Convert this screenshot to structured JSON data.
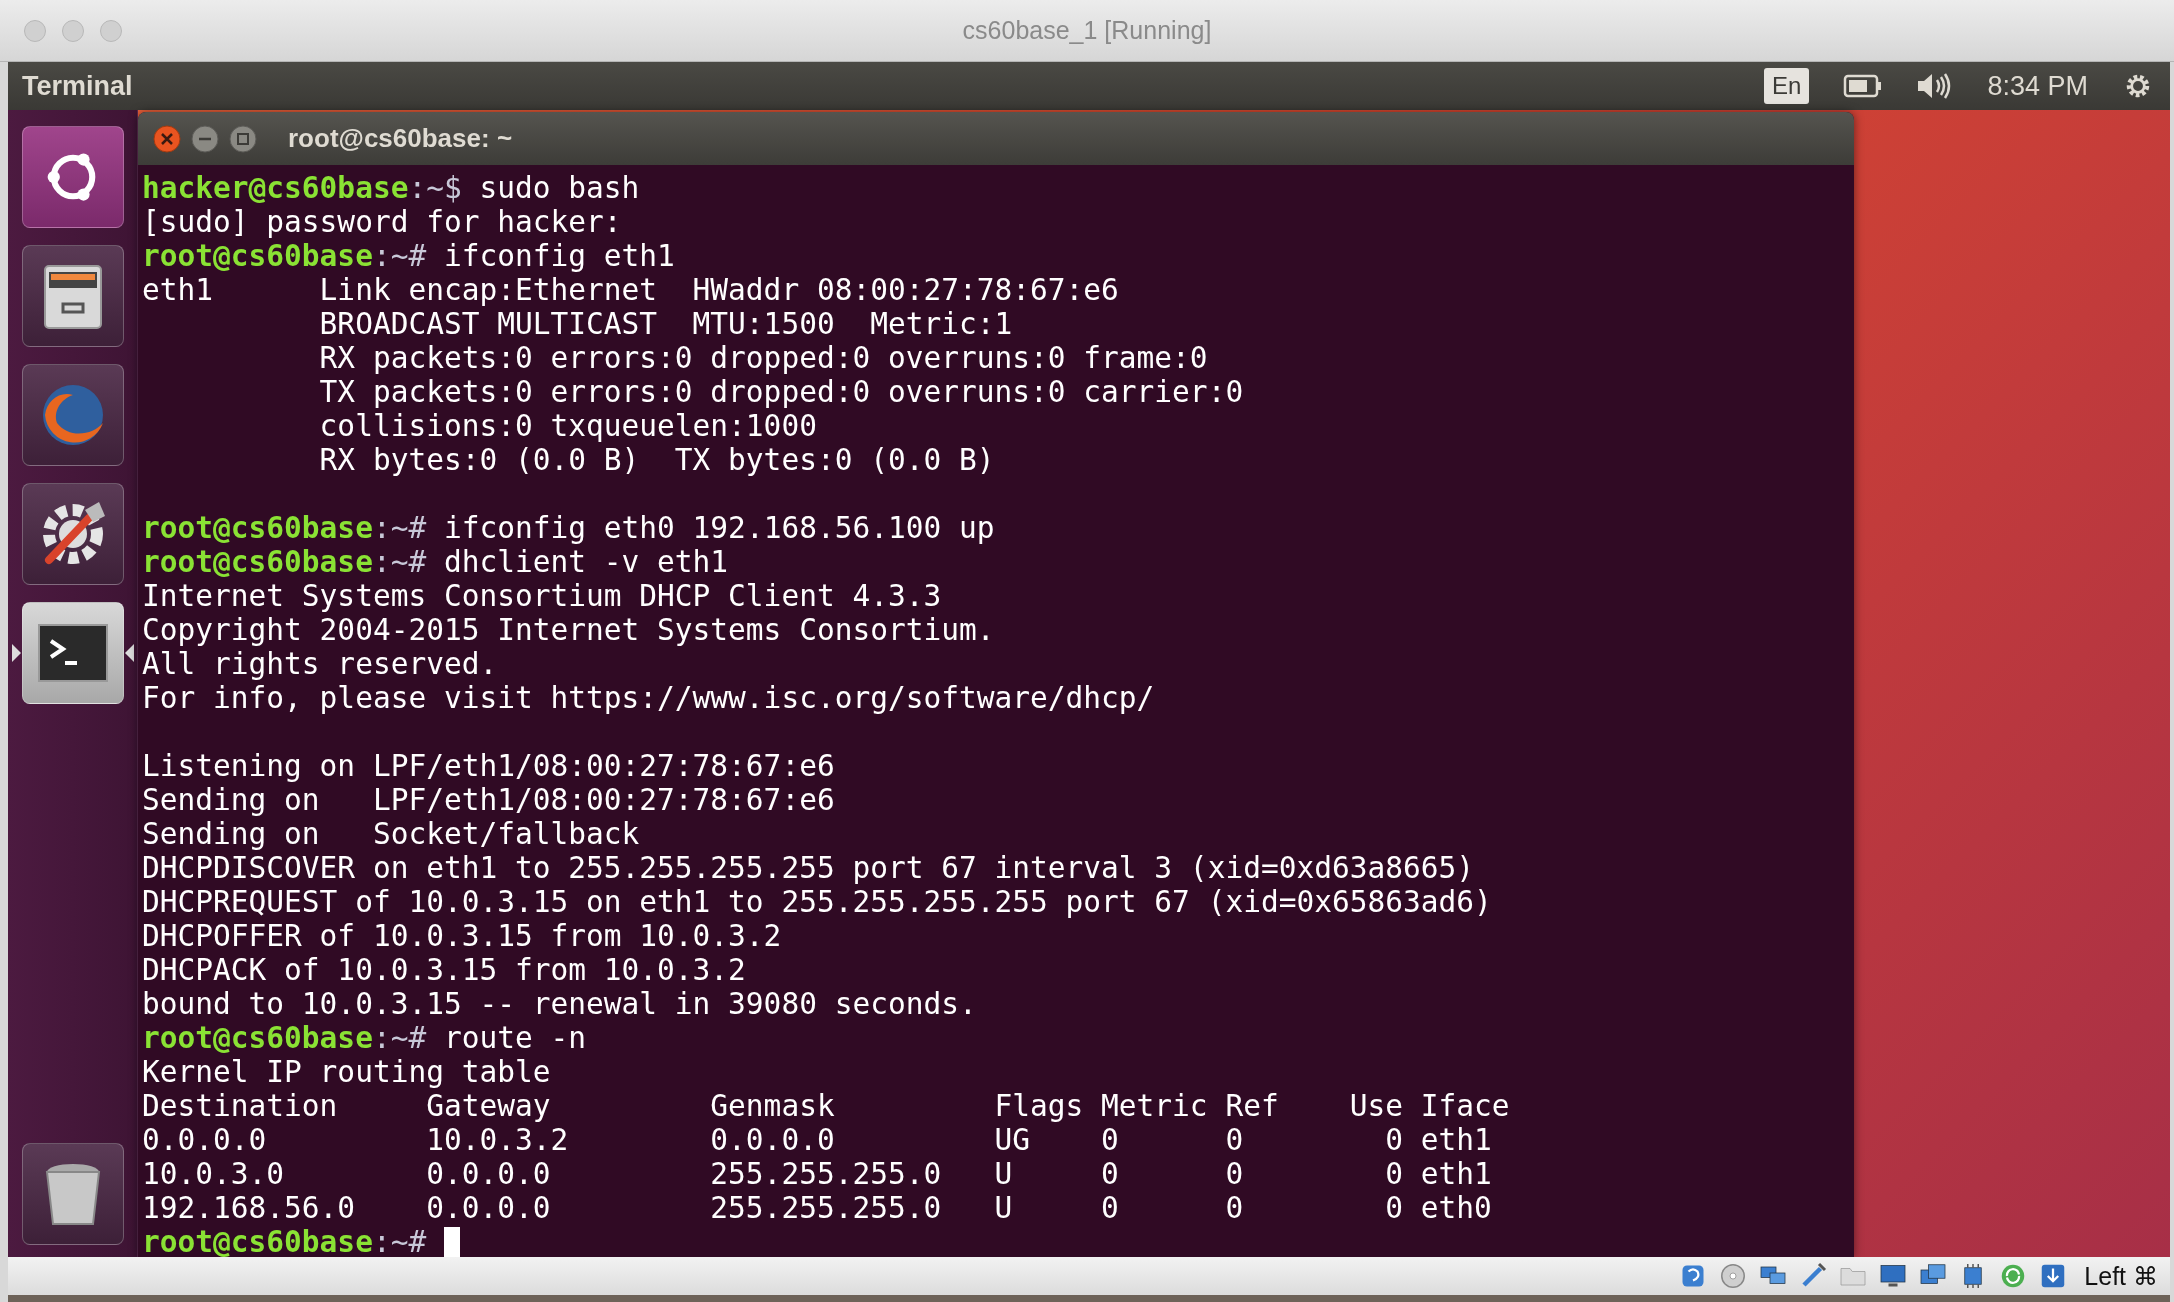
{
  "window": {
    "title": "cs60base_1 [Running]"
  },
  "top_panel": {
    "app_name": "Terminal",
    "keyboard": "En",
    "time": "8:34 PM"
  },
  "launcher": [
    {
      "kind": "dash",
      "running": false,
      "focused": false
    },
    {
      "kind": "files",
      "running": false,
      "focused": false
    },
    {
      "kind": "browser",
      "running": false,
      "focused": false
    },
    {
      "kind": "settings",
      "running": false,
      "focused": false
    },
    {
      "kind": "terminal",
      "running": true,
      "focused": true
    },
    {
      "kind": "trash",
      "running": false,
      "focused": false
    }
  ],
  "terminal": {
    "title": "root@cs60base: ~",
    "lines": [
      {
        "kind": "prompt",
        "user": "hacker@cs60base",
        "sign": ":~$",
        "command": " sudo bash"
      },
      {
        "kind": "output",
        "text": "[sudo] password for hacker:"
      },
      {
        "kind": "prompt",
        "user": "root@cs60base",
        "sign": ":~#",
        "command": " ifconfig eth1"
      },
      {
        "kind": "output",
        "text": "eth1      Link encap:Ethernet  HWaddr 08:00:27:78:67:e6"
      },
      {
        "kind": "output",
        "text": "          BROADCAST MULTICAST  MTU:1500  Metric:1"
      },
      {
        "kind": "output",
        "text": "          RX packets:0 errors:0 dropped:0 overruns:0 frame:0"
      },
      {
        "kind": "output",
        "text": "          TX packets:0 errors:0 dropped:0 overruns:0 carrier:0"
      },
      {
        "kind": "output",
        "text": "          collisions:0 txqueuelen:1000"
      },
      {
        "kind": "output",
        "text": "          RX bytes:0 (0.0 B)  TX bytes:0 (0.0 B)"
      },
      {
        "kind": "blank"
      },
      {
        "kind": "prompt",
        "user": "root@cs60base",
        "sign": ":~#",
        "command": " ifconfig eth0 192.168.56.100 up"
      },
      {
        "kind": "prompt",
        "user": "root@cs60base",
        "sign": ":~#",
        "command": " dhclient -v eth1"
      },
      {
        "kind": "output",
        "text": "Internet Systems Consortium DHCP Client 4.3.3"
      },
      {
        "kind": "output",
        "text": "Copyright 2004-2015 Internet Systems Consortium."
      },
      {
        "kind": "output",
        "text": "All rights reserved."
      },
      {
        "kind": "output",
        "text": "For info, please visit https://www.isc.org/software/dhcp/"
      },
      {
        "kind": "blank"
      },
      {
        "kind": "output",
        "text": "Listening on LPF/eth1/08:00:27:78:67:e6"
      },
      {
        "kind": "output",
        "text": "Sending on   LPF/eth1/08:00:27:78:67:e6"
      },
      {
        "kind": "output",
        "text": "Sending on   Socket/fallback"
      },
      {
        "kind": "output",
        "text": "DHCPDISCOVER on eth1 to 255.255.255.255 port 67 interval 3 (xid=0xd63a8665)"
      },
      {
        "kind": "output",
        "text": "DHCPREQUEST of 10.0.3.15 on eth1 to 255.255.255.255 port 67 (xid=0x65863ad6)"
      },
      {
        "kind": "output",
        "text": "DHCPOFFER of 10.0.3.15 from 10.0.3.2"
      },
      {
        "kind": "output",
        "text": "DHCPACK of 10.0.3.15 from 10.0.3.2"
      },
      {
        "kind": "output",
        "text": "bound to 10.0.3.15 -- renewal in 39080 seconds."
      },
      {
        "kind": "prompt",
        "user": "root@cs60base",
        "sign": ":~#",
        "command": " route -n"
      },
      {
        "kind": "output",
        "text": "Kernel IP routing table"
      },
      {
        "kind": "output",
        "text": "Destination     Gateway         Genmask         Flags Metric Ref    Use Iface"
      },
      {
        "kind": "output",
        "text": "0.0.0.0         10.0.3.2        0.0.0.0         UG    0      0        0 eth1"
      },
      {
        "kind": "output",
        "text": "10.0.3.0        0.0.0.0         255.255.255.0   U     0      0        0 eth1"
      },
      {
        "kind": "output",
        "text": "192.168.56.0    0.0.0.0         255.255.255.0   U     0      0        0 eth0"
      },
      {
        "kind": "prompt",
        "user": "root@cs60base",
        "sign": ":~#",
        "cursor": true
      }
    ]
  },
  "status_bar": {
    "host_key": "Left ⌘"
  }
}
